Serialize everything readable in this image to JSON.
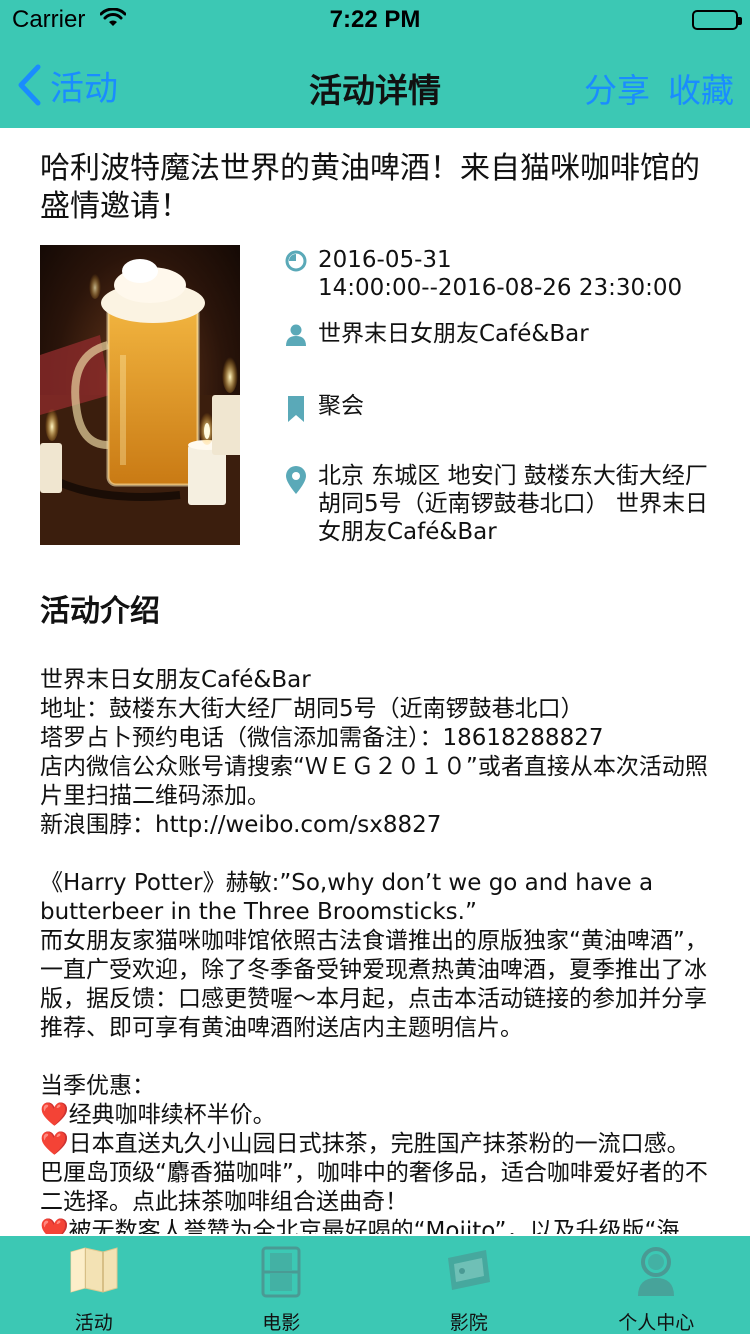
{
  "status_bar": {
    "carrier": "Carrier",
    "time": "7:22 PM"
  },
  "nav": {
    "back_label": "活动",
    "title": "活动详情",
    "share_label": "分享",
    "favorite_label": "收藏"
  },
  "event": {
    "title": "哈利波特魔法世界的黄油啤酒！来自猫咪咖啡馆的盛情邀请！",
    "time": "2016-05-31\n14:00:00--2016-08-26 23:30:00",
    "organizer": "世界末日女朋友Café&Bar",
    "category": "聚会",
    "address": "北京 东城区 地安门 鼓楼东大街大经厂胡同5号（近南锣鼓巷北口） 世界末日女朋友Café&Bar"
  },
  "intro": {
    "heading": "活动介绍",
    "paragraphs": [
      "世界末日女朋友Café&Bar",
      "地址：鼓楼东大街大经厂胡同5号（近南锣鼓巷北口）",
      "塔罗占卜预约电话（微信添加需备注）：18618288827",
      "店内微信公众账号请搜索“ＷＥＧ２０１０”或者直接从本次活动照片里扫描二维码添加。",
      "新浪围脖：http://weibo.com/sx8827",
      "",
      "《Harry Potter》赫敏:”So,why don’t we go and have a butterbeer in the Three Broomsticks.”",
      "而女朋友家猫咪咖啡馆依照古法食谱推出的原版独家“黄油啤酒”，一直广受欢迎，除了冬季备受钟爱现煮热黄油啤酒，夏季推出了冰版，据反馈：口感更赞喔～本月起，点击本活动链接的参加并分享推荐、即可享有黄油啤酒附送店内主题明信片。",
      "",
      "当季优惠："
    ],
    "offers": [
      "经典咖啡续杯半价。",
      "日本直送丸久小山园日式抹茶，完胜国产抹茶粉的一流口感。巴厘岛顶级“麝香猫咖啡”，咖啡中的奢侈品，适合咖啡爱好者的不二选择。点此抹茶咖啡组合送曲奇！",
      "被无数客人誉赞为全北京最好喝的“Mojito”，以及升级版“海"
    ],
    "offer_bullet": "❤️"
  },
  "tabbar": {
    "tabs": [
      {
        "label": "活动",
        "icon": "map-icon",
        "active": true
      },
      {
        "label": "电影",
        "icon": "film-icon",
        "active": false
      },
      {
        "label": "影院",
        "icon": "cinema-icon",
        "active": false
      },
      {
        "label": "个人中心",
        "icon": "profile-icon",
        "active": false
      }
    ]
  },
  "colors": {
    "accent": "#3cc8b4",
    "link": "#1a8cff",
    "icon": "#5aa9b8"
  }
}
